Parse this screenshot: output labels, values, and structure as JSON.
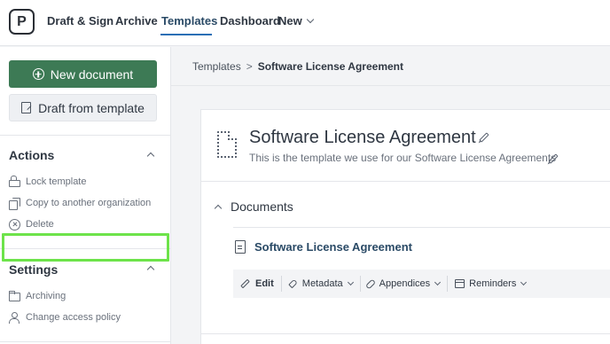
{
  "logo": {
    "letter": "P"
  },
  "nav": {
    "items": [
      {
        "label": "Draft & Sign"
      },
      {
        "label": "Archive"
      },
      {
        "label": "Templates"
      },
      {
        "label": "Dashboard"
      },
      {
        "label": "New"
      }
    ],
    "active": "Templates"
  },
  "sidebar": {
    "new_document": "New document",
    "draft_from_template": "Draft from template",
    "actions": {
      "title": "Actions",
      "items": [
        {
          "label": "Lock template",
          "icon": "lock-icon"
        },
        {
          "label": "Copy to another organization",
          "icon": "copy-icon"
        },
        {
          "label": "Delete",
          "icon": "delete-icon"
        }
      ]
    },
    "settings": {
      "title": "Settings",
      "items": [
        {
          "label": "Archiving",
          "icon": "folder-icon"
        },
        {
          "label": "Change access policy",
          "icon": "user-lock-icon"
        }
      ]
    }
  },
  "breadcrumb": {
    "parent": "Templates",
    "separator": ">",
    "current": "Software License Agreement"
  },
  "template": {
    "title": "Software License Agreement",
    "description": "This is the template we use for our Software License Agreements"
  },
  "documents": {
    "heading": "Documents",
    "items": [
      {
        "name": "Software License Agreement"
      }
    ],
    "toolbar": {
      "edit": "Edit",
      "metadata": "Metadata",
      "appendices": "Appendices",
      "reminders": "Reminders"
    }
  },
  "colors": {
    "primary_button": "#3d7a55",
    "nav_active_underline": "#2a6fb5",
    "link": "#2a4a66",
    "highlight": "#6de34a"
  }
}
